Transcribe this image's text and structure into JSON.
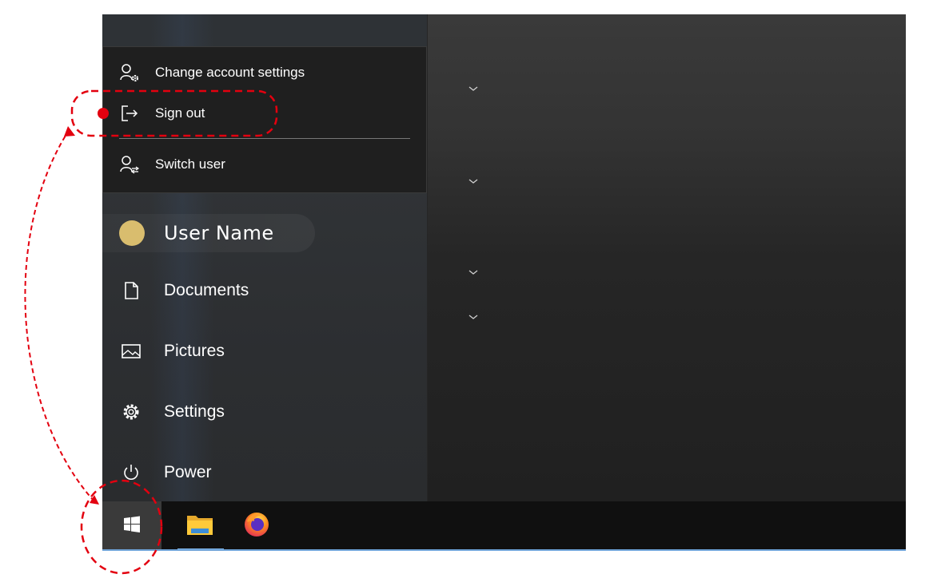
{
  "account_menu": {
    "items": [
      {
        "label": "Change account settings",
        "icon": "account-settings-icon"
      },
      {
        "label": "Sign out",
        "icon": "sign-out-icon"
      },
      {
        "label": "Switch user",
        "icon": "switch-user-icon"
      }
    ]
  },
  "start_menu": {
    "user": {
      "label": "User Name",
      "avatar_color": "#d9bd6e"
    },
    "nav": [
      {
        "label": "Documents",
        "icon": "document-icon"
      },
      {
        "label": "Pictures",
        "icon": "pictures-icon"
      },
      {
        "label": "Settings",
        "icon": "gear-icon"
      },
      {
        "label": "Power",
        "icon": "power-icon"
      }
    ]
  },
  "taskbar": {
    "apps": [
      "windows-start-icon",
      "file-explorer-icon",
      "firefox-icon"
    ],
    "accent": "#6fa3d8"
  },
  "annotation": {
    "color": "#e3000f"
  }
}
